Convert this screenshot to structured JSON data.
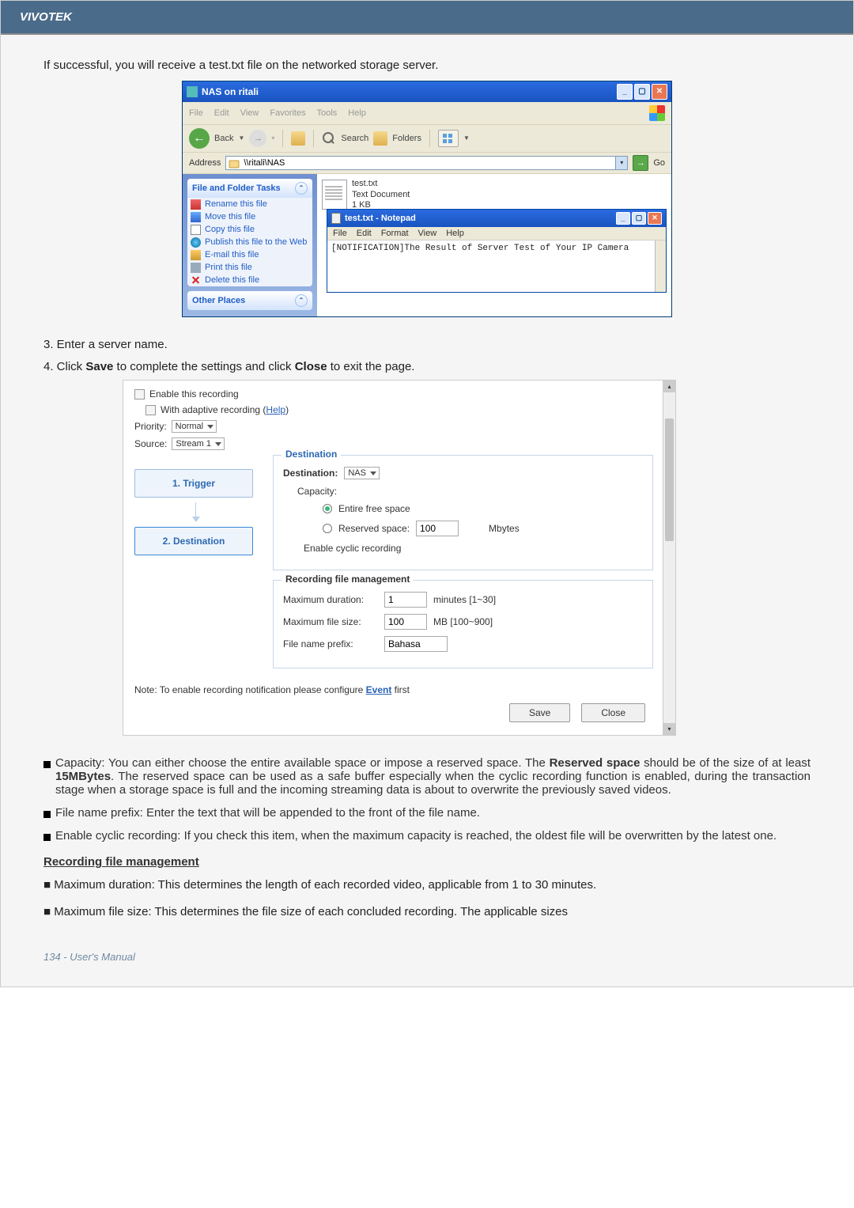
{
  "brand": "VIVOTEK",
  "footer": "134 - User's Manual",
  "intro": "If successful, you will receive a test.txt file on the networked storage server.",
  "xp": {
    "title": "NAS on ritali",
    "menu": {
      "file": "File",
      "edit": "Edit",
      "view": "View",
      "favorites": "Favorites",
      "tools": "Tools",
      "help": "Help"
    },
    "toolbar": {
      "back": "Back",
      "search": "Search",
      "folders": "Folders"
    },
    "address_label": "Address",
    "address_value": "\\\\ritali\\NAS",
    "go": "Go",
    "panels": {
      "tasks_title": "File and Folder Tasks",
      "tasks": {
        "rename": "Rename this file",
        "move": "Move this file",
        "copy": "Copy this file",
        "publish": "Publish this file to the Web",
        "email": "E-mail this file",
        "print": "Print this file",
        "delete": "Delete this file"
      },
      "other_title": "Other Places"
    },
    "file": {
      "name": "test.txt",
      "type": "Text Document",
      "size": "1 KB"
    },
    "notepad": {
      "title": "test.txt - Notepad",
      "menu": {
        "file": "File",
        "edit": "Edit",
        "format": "Format",
        "view": "View",
        "help": "Help"
      },
      "body": "[NOTIFICATION]The Result of Server Test of Your IP Camera"
    }
  },
  "steps": {
    "s3": "3. Enter a server name.",
    "s4_pre": "4. Click ",
    "s4_save": "Save",
    "s4_mid": " to complete the settings and click ",
    "s4_close": "Close",
    "s4_post": " to exit the page."
  },
  "rec": {
    "enable": "Enable this recording",
    "adaptive": "With adaptive recording (",
    "help": "Help",
    "adaptive_close": ")",
    "priority_label": "Priority:",
    "priority_value": "Normal",
    "source_label": "Source:",
    "source_value": "Stream 1",
    "wiz": {
      "s1": "1.  Trigger",
      "s2": "2.  Destination"
    },
    "dest": {
      "legend": "Destination",
      "label": "Destination:",
      "value": "NAS",
      "capacity": "Capacity:",
      "entire": "Entire free space",
      "reserved": "Reserved space:",
      "reserved_val": "100",
      "mbytes": "Mbytes",
      "cyclic": "Enable cyclic recording"
    },
    "mgmt": {
      "legend": "Recording file management",
      "maxdur_label": "Maximum duration:",
      "maxdur_val": "1",
      "maxdur_hint": "minutes [1~30]",
      "maxfs_label": "Maximum file size:",
      "maxfs_val": "100",
      "maxfs_hint": "MB [100~900]",
      "prefix_label": "File name prefix:",
      "prefix_val": "Bahasa"
    },
    "note_pre": "Note: To enable recording notification please configure ",
    "note_link": "Event",
    "note_post": " first",
    "save_btn": "Save",
    "close_btn": "Close"
  },
  "bullets": {
    "cap_pre": "Capacity: You can either choose the entire available space or impose a reserved space. The ",
    "cap_b1": "Reserved space",
    "cap_mid1": " should be of the size of at least ",
    "cap_b2": "15MBytes",
    "cap_post": ". The reserved space can be used as a safe buffer especially when the cyclic recording function is enabled, during the transaction stage when a storage space is full and the incoming streaming data is about to overwrite the previously saved videos.",
    "prefix": "File name prefix: Enter the text that will be appended to the front of the file name.",
    "cyclic": "Enable cyclic recording: If you check this item, when the maximum capacity is reached, the oldest file will be overwritten by the latest one."
  },
  "heading_rfm": "Recording file management",
  "para_maxdur": "■ Maximum duration: This determines the length of each recorded video, applicable from 1 to 30 minutes.",
  "para_maxfs": "■ Maximum file size: This determines the file size of each concluded recording. The applicable sizes"
}
